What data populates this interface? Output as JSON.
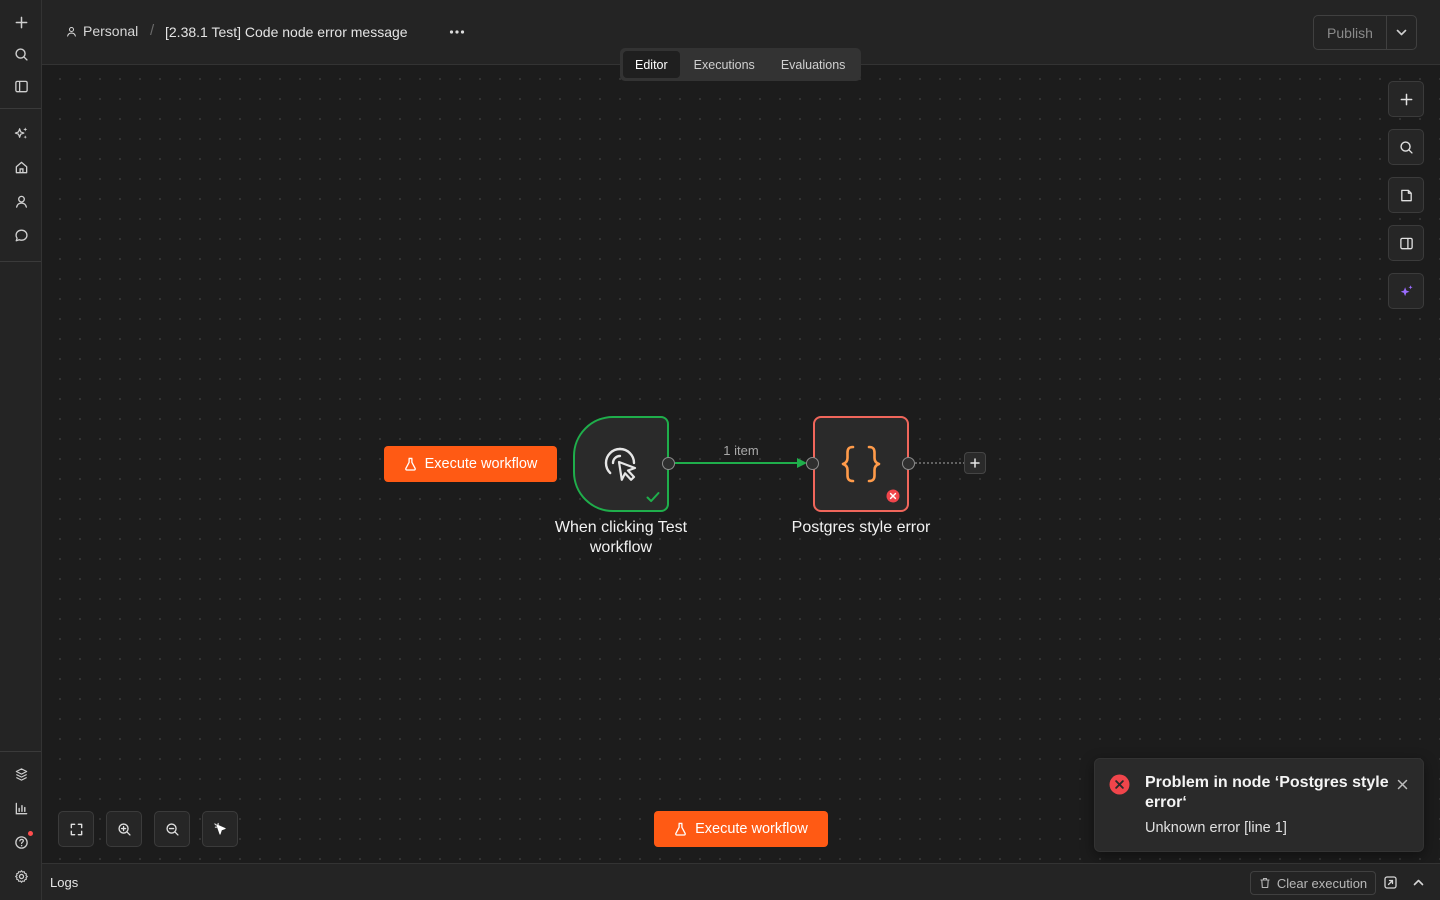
{
  "sidebar": {
    "top_items": [
      "add-icon",
      "search-icon",
      "toggle-sidebar-icon"
    ],
    "nav_items": [
      "sparkle-icon",
      "home-icon",
      "user-icon",
      "chat-icon"
    ],
    "bottom_items": [
      "templates-icon",
      "insights-icon",
      "help-icon",
      "settings-icon"
    ]
  },
  "header": {
    "project": "Personal",
    "workflow_title": "[2.38.1 Test] Code node error message",
    "tabs": [
      {
        "label": "Editor",
        "active": true
      },
      {
        "label": "Executions",
        "active": false
      },
      {
        "label": "Evaluations",
        "active": false
      }
    ],
    "publish_label": "Publish"
  },
  "canvas": {
    "execute_button_label": "Execute workflow",
    "nodes": [
      {
        "label": "When clicking Test workflow",
        "status": "success",
        "icon": "cursor-click-icon"
      },
      {
        "label": "Postgres style error",
        "status": "error",
        "icon": "code-braces-icon"
      }
    ],
    "edge_label": "1 item",
    "colors": {
      "accent": "#ff5a14",
      "success": "#1fae4b",
      "error": "#f0665b",
      "ai": "#9b6cff"
    }
  },
  "bottom_execute_label": "Execute workflow",
  "toast": {
    "title": "Problem in node ‘Postgres style error‘",
    "message": "Unknown error [line 1]"
  },
  "logs": {
    "label": "Logs",
    "clear_label": "Clear execution"
  }
}
